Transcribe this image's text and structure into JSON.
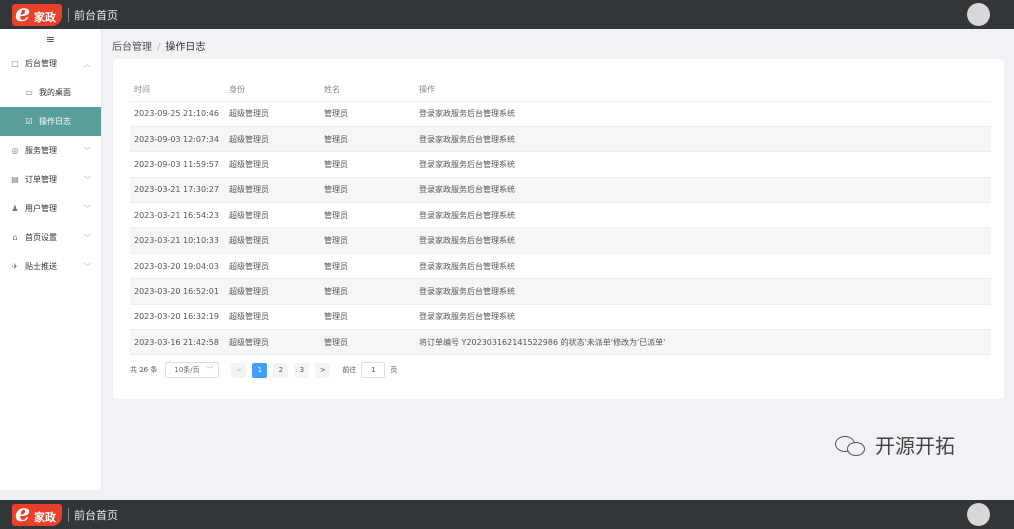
{
  "topbar": {
    "logo_letter": "e",
    "logo_text": "家政",
    "home_label": "前台首页"
  },
  "sidebar": {
    "collapse_icon": "≡",
    "items": [
      {
        "label": "后台管理",
        "icon": "□",
        "chev": "︿",
        "type": "group"
      },
      {
        "label": "我的桌面",
        "icon": "▭",
        "type": "sub"
      },
      {
        "label": "操作日志",
        "icon": "☑",
        "type": "sub",
        "active": true
      },
      {
        "label": "服务管理",
        "icon": "◎",
        "chev": "﹀",
        "type": "group"
      },
      {
        "label": "订单管理",
        "icon": "▤",
        "chev": "﹀",
        "type": "group"
      },
      {
        "label": "用户管理",
        "icon": "♟",
        "chev": "﹀",
        "type": "group"
      },
      {
        "label": "首页设置",
        "icon": "⌂",
        "chev": "﹀",
        "type": "group"
      },
      {
        "label": "贴士推送",
        "icon": "✈",
        "chev": "﹀",
        "type": "group"
      }
    ]
  },
  "breadcrumb": {
    "root": "后台管理",
    "separator": "/",
    "current": "操作日志"
  },
  "table": {
    "headers": [
      "时间",
      "身份",
      "姓名",
      "操作"
    ],
    "rows": [
      [
        "2023-09-25 21:10:46",
        "超级管理员",
        "管理员",
        "登录家政服务后台管理系统"
      ],
      [
        "2023-09-03 12:07:34",
        "超级管理员",
        "管理员",
        "登录家政服务后台管理系统"
      ],
      [
        "2023-09-03 11:59:57",
        "超级管理员",
        "管理员",
        "登录家政服务后台管理系统"
      ],
      [
        "2023-03-21 17:30:27",
        "超级管理员",
        "管理员",
        "登录家政服务后台管理系统"
      ],
      [
        "2023-03-21 16:54:23",
        "超级管理员",
        "管理员",
        "登录家政服务后台管理系统"
      ],
      [
        "2023-03-21 10:10:33",
        "超级管理员",
        "管理员",
        "登录家政服务后台管理系统"
      ],
      [
        "2023-03-20 19:04:03",
        "超级管理员",
        "管理员",
        "登录家政服务后台管理系统"
      ],
      [
        "2023-03-20 16:52:01",
        "超级管理员",
        "管理员",
        "登录家政服务后台管理系统"
      ],
      [
        "2023-03-20 16:32:19",
        "超级管理员",
        "管理员",
        "登录家政服务后台管理系统"
      ],
      [
        "2023-03-16 21:42:58",
        "超级管理员",
        "管理员",
        "将订单编号 Y202303162141522986 的状态'未派单'修改为'已派单'"
      ]
    ]
  },
  "pagination": {
    "total": "共 26 条",
    "page_size": "10条/页",
    "prev": "<",
    "pages": [
      "1",
      "2",
      "3"
    ],
    "current_page": "1",
    "next": ">",
    "goto_label": "前往",
    "goto_value": "1",
    "page_unit": "页"
  },
  "watermark": {
    "text": "开源开拓"
  },
  "colors": {
    "topbar": "#333638",
    "sidebar_active": "#5a9e9b",
    "logo": "#e8402a",
    "pager_active": "#409eff"
  }
}
